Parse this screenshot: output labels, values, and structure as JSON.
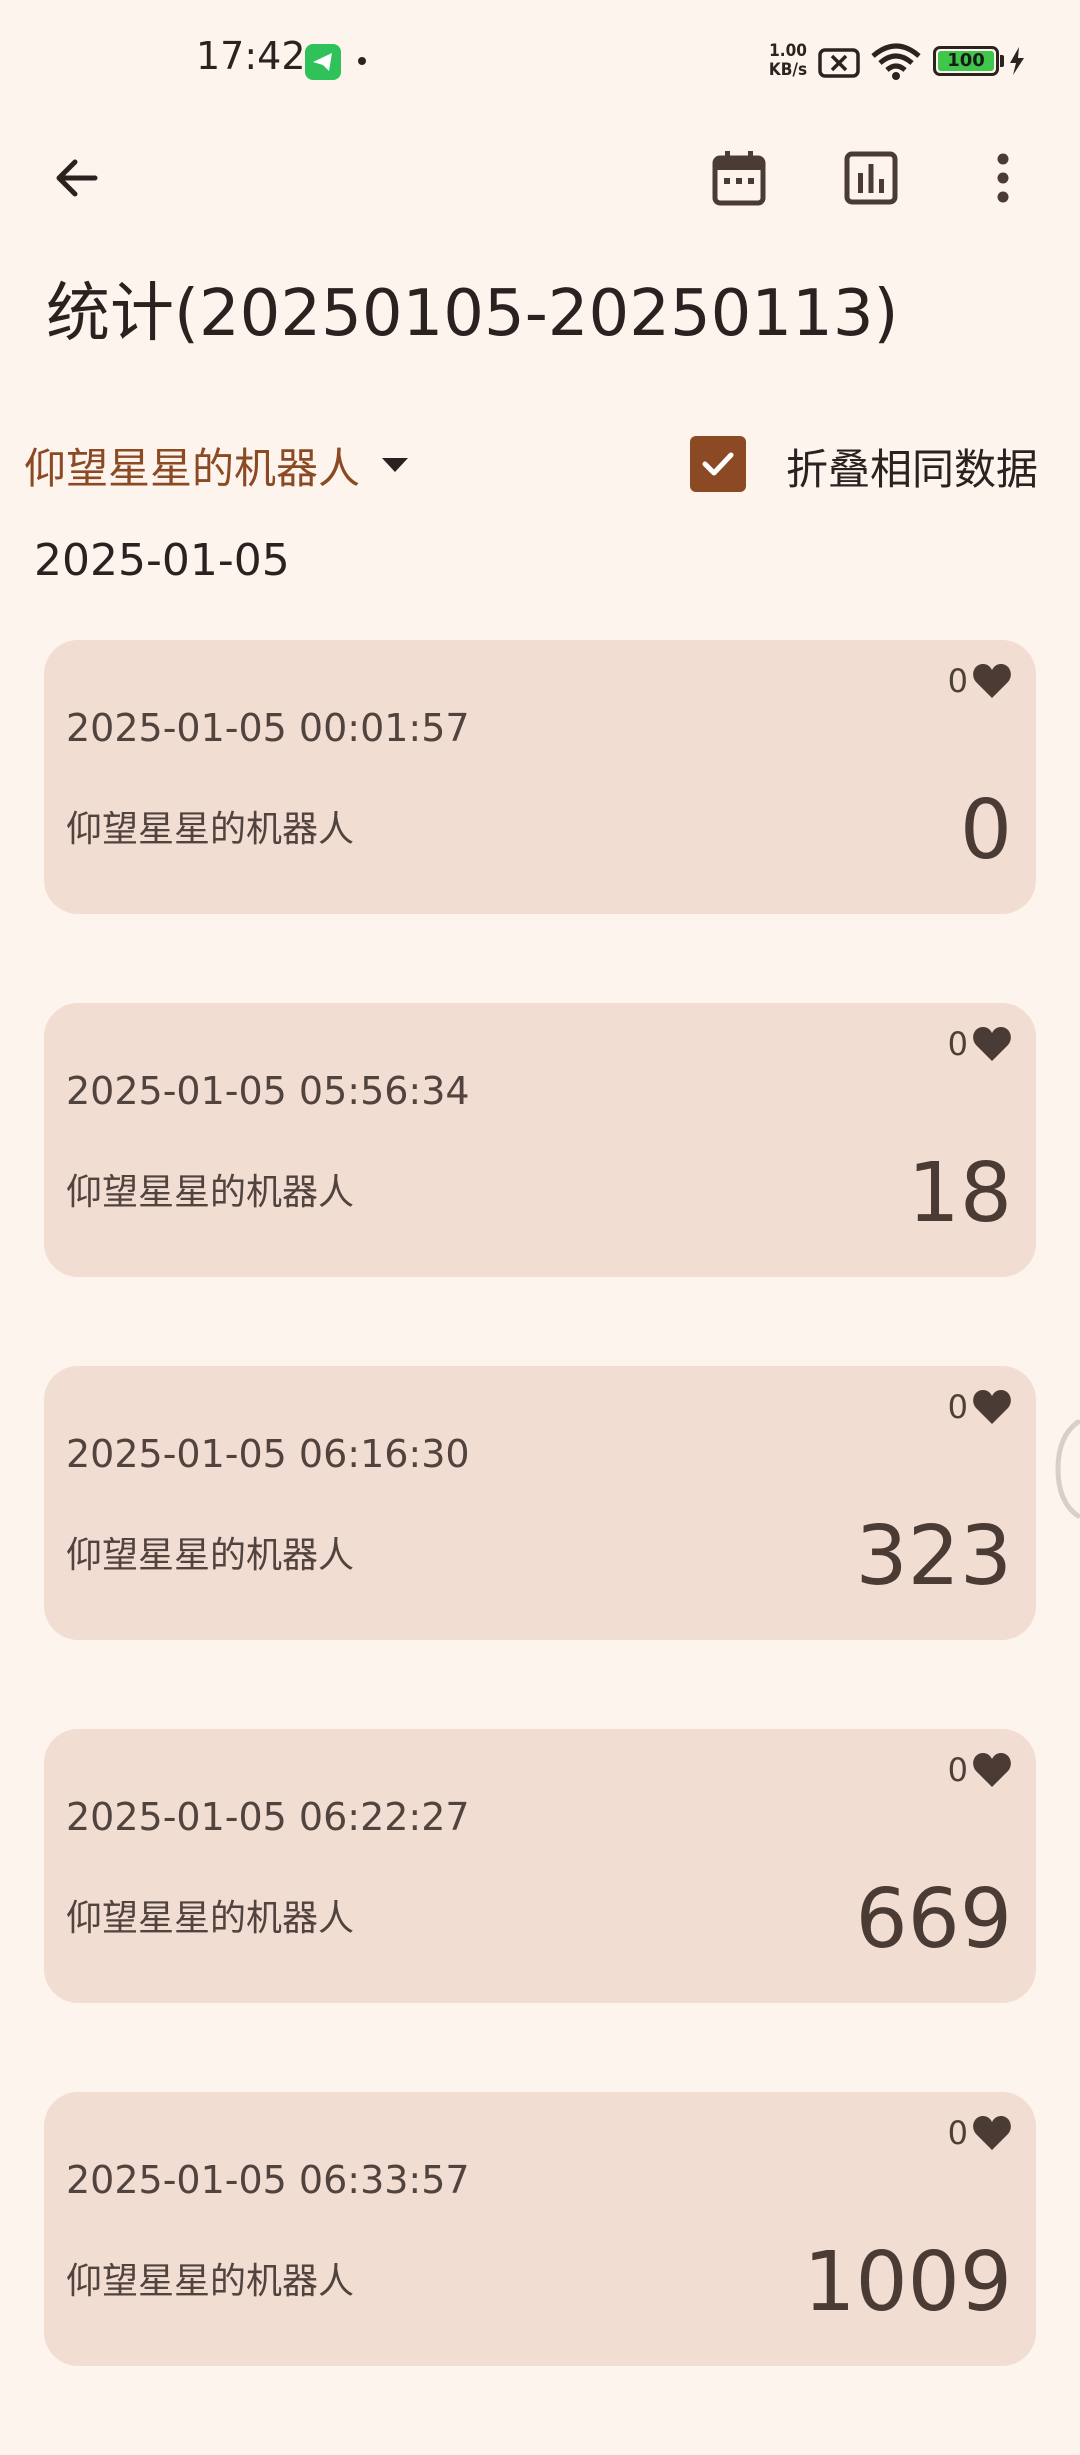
{
  "status_bar": {
    "time": "17:42",
    "net_speed_value": "1.00",
    "net_speed_unit": "KB/s",
    "battery": "100"
  },
  "toolbar": {
    "back_icon": "arrow-left-icon",
    "calendar_icon": "calendar-icon",
    "chart_icon": "bar-chart-icon",
    "more_icon": "more-vertical-icon"
  },
  "title": "统计(20250105-20250113)",
  "filter": {
    "user": "仰望星星的机器人",
    "fold_label": "折叠相同数据",
    "fold_checked": true
  },
  "date_group": "2025-01-05",
  "records": [
    {
      "time": "2025-01-05 00:01:57",
      "name": "仰望星星的机器人",
      "value": "0",
      "likes": "0"
    },
    {
      "time": "2025-01-05 05:56:34",
      "name": "仰望星星的机器人",
      "value": "18",
      "likes": "0"
    },
    {
      "time": "2025-01-05 06:16:30",
      "name": "仰望星星的机器人",
      "value": "323",
      "likes": "0"
    },
    {
      "time": "2025-01-05 06:22:27",
      "name": "仰望星星的机器人",
      "value": "669",
      "likes": "0"
    },
    {
      "time": "2025-01-05 06:33:57",
      "name": "仰望星星的机器人",
      "value": "1009",
      "likes": "0"
    }
  ],
  "colors": {
    "background": "#fdf4ee",
    "card": "#f2ddd2",
    "accent": "#8b4a23",
    "text": "#2a2220"
  }
}
